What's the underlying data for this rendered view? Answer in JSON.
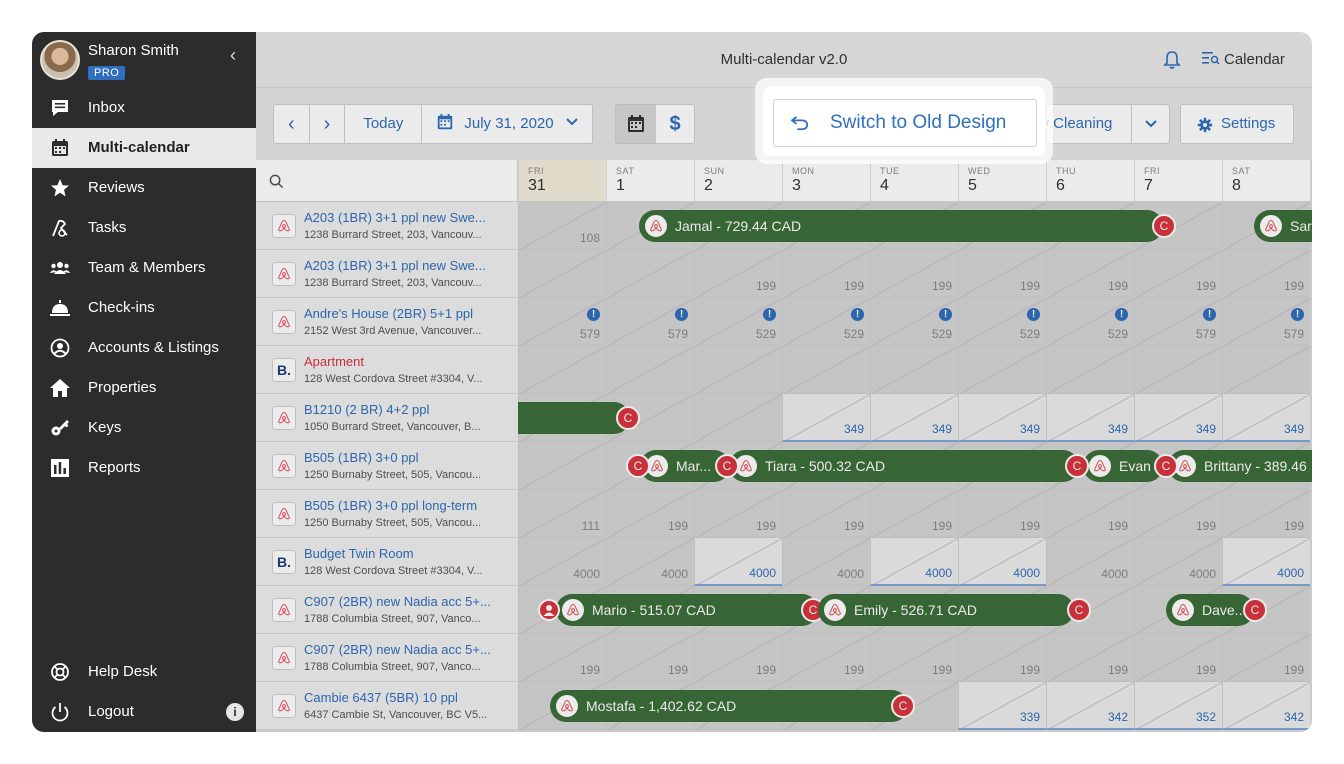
{
  "app": {
    "title": "Multi-calendar v2.0",
    "calendar_view": "Calendar"
  },
  "user": {
    "name": "Sharon Smith",
    "plan": "PRO"
  },
  "sidebar": {
    "items": [
      {
        "label": "Inbox",
        "icon": "inbox-icon"
      },
      {
        "label": "Multi-calendar",
        "icon": "calendar-icon",
        "active": true
      },
      {
        "label": "Reviews",
        "icon": "star-icon"
      },
      {
        "label": "Tasks",
        "icon": "tasks-icon"
      },
      {
        "label": "Team & Members",
        "icon": "team-icon"
      },
      {
        "label": "Check-ins",
        "icon": "bell-service-icon"
      },
      {
        "label": "Accounts & Listings",
        "icon": "account-icon"
      },
      {
        "label": "Properties",
        "icon": "home-icon"
      },
      {
        "label": "Keys",
        "icon": "key-icon"
      },
      {
        "label": "Reports",
        "icon": "reports-icon"
      }
    ],
    "bottom": [
      {
        "label": "Help Desk",
        "icon": "lifebuoy-icon"
      },
      {
        "label": "Logout",
        "icon": "power-icon"
      }
    ]
  },
  "toolbar": {
    "prev": "‹",
    "next": "›",
    "today": "Today",
    "date": "July 31, 2020",
    "cleaning_label": "New Cleaning",
    "settings_label": "Settings",
    "switch_label": "Switch to Old Design"
  },
  "days": [
    {
      "dow": "FRI",
      "num": "31",
      "today": true
    },
    {
      "dow": "SAT",
      "num": "1"
    },
    {
      "dow": "SUN",
      "num": "2"
    },
    {
      "dow": "MON",
      "num": "3"
    },
    {
      "dow": "TUE",
      "num": "4"
    },
    {
      "dow": "WED",
      "num": "5"
    },
    {
      "dow": "THU",
      "num": "6"
    },
    {
      "dow": "FRI",
      "num": "7"
    },
    {
      "dow": "SAT",
      "num": "8"
    }
  ],
  "listings": [
    {
      "name": "A203 (1BR) 3+1 ppl new Swe...",
      "addr": "1238 Burrard Street, 203, Vancouv...",
      "src": "airbnb",
      "prices": [
        "108",
        "",
        "",
        "",
        "",
        "",
        "",
        "",
        ""
      ]
    },
    {
      "name": "A203 (1BR) 3+1 ppl new Swe...",
      "addr": "1238 Burrard Street, 203, Vancouv...",
      "src": "airbnb",
      "prices": [
        "",
        "",
        "199",
        "199",
        "199",
        "199",
        "199",
        "199",
        "199"
      ]
    },
    {
      "name": "Andre's House (2BR) 5+1 ppl",
      "addr": "2152 West 3rd Avenue, Vancouver...",
      "src": "airbnb",
      "prices": [
        "579",
        "579",
        "529",
        "529",
        "529",
        "529",
        "529",
        "579",
        "579"
      ]
    },
    {
      "name": "Apartment",
      "addr": "128 West Cordova Street #3304, V...",
      "src": "booking",
      "prices": [
        "",
        "",
        "",
        "",
        "",
        "",
        "",
        "",
        ""
      ]
    },
    {
      "name": "B1210 (2 BR) 4+2 ppl",
      "addr": "1050 Burrard Street, Vancouver, B...",
      "src": "airbnb",
      "prices": [
        "",
        "",
        "",
        "349",
        "349",
        "349",
        "349",
        "349",
        "349"
      ]
    },
    {
      "name": "B505 (1BR) 3+0 ppl",
      "addr": "1250 Burnaby Street, 505, Vancou...",
      "src": "airbnb",
      "prices": [
        "",
        "",
        "",
        "",
        "",
        "",
        "",
        "",
        ""
      ]
    },
    {
      "name": "B505 (1BR) 3+0 ppl long-term",
      "addr": "1250 Burnaby Street, 505, Vancou...",
      "src": "airbnb",
      "prices": [
        "111",
        "199",
        "199",
        "199",
        "199",
        "199",
        "199",
        "199",
        "199"
      ]
    },
    {
      "name": "Budget Twin Room",
      "addr": "128 West Cordova Street #3304, V...",
      "src": "booking",
      "prices": [
        "4000",
        "4000",
        "4000",
        "4000",
        "4000",
        "4000",
        "4000",
        "4000",
        "4000"
      ]
    },
    {
      "name": "C907 (2BR) new Nadia acc 5+...",
      "addr": "1788 Columbia Street, 907, Vanco...",
      "src": "airbnb",
      "prices": [
        "",
        "",
        "",
        "",
        "",
        "",
        "",
        "",
        ""
      ]
    },
    {
      "name": "C907 (2BR) new Nadia acc 5+...",
      "addr": "1788 Columbia Street, 907, Vanco...",
      "src": "airbnb",
      "prices": [
        "199",
        "199",
        "199",
        "199",
        "199",
        "199",
        "199",
        "199",
        "199"
      ]
    },
    {
      "name": "Cambie 6437 (5BR) 10 ppl",
      "addr": "6437 Cambie St, Vancouver, BC V5...",
      "src": "airbnb",
      "prices": [
        "",
        "",
        "",
        "",
        "",
        "339",
        "342",
        "352",
        "342"
      ]
    }
  ],
  "bookings": [
    {
      "row": 0,
      "label": "Jamal - 729.44 CAD"
    },
    {
      "row": 0,
      "label": "Sar"
    },
    {
      "row": 4,
      "label": ""
    },
    {
      "row": 5,
      "label": "Mar..."
    },
    {
      "row": 5,
      "label": "Tiara - 500.32 CAD"
    },
    {
      "row": 5,
      "label": "Evan ..."
    },
    {
      "row": 5,
      "label": "Brittany - 389.46"
    },
    {
      "row": 8,
      "label": "Mario - 515.07 CAD"
    },
    {
      "row": 8,
      "label": "Emily - 526.71 CAD"
    },
    {
      "row": 8,
      "label": "Dave..."
    },
    {
      "row": 10,
      "label": "Mostafa - 1,402.62 CAD"
    }
  ],
  "colors": {
    "accent": "#2f6fbd",
    "booking": "#3d6e3a",
    "badge": "#d9363e",
    "sidebar": "#2c2c2c"
  }
}
